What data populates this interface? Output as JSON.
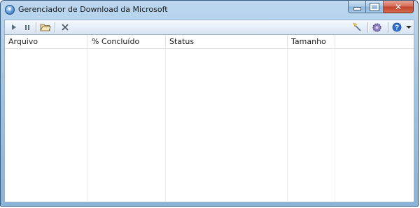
{
  "window": {
    "title": "Gerenciador de Download da Microsoft"
  },
  "caption_buttons": {
    "close_glyph": "✕"
  },
  "toolbar": {
    "icons": [
      "play-icon",
      "pause-icon",
      "open-folder-icon",
      "cancel-icon",
      "clean-up-icon",
      "settings-icon",
      "help-icon",
      "dropdown-arrow-icon"
    ]
  },
  "list": {
    "columns": [
      {
        "label": "Arquivo"
      },
      {
        "label": "% Concluído"
      },
      {
        "label": "Status"
      },
      {
        "label": "Tamanho"
      }
    ],
    "rows": []
  },
  "colors": {
    "frame": "#9fc3e3",
    "close_button": "#c0412a",
    "toolbar": "#e3ecf7"
  }
}
